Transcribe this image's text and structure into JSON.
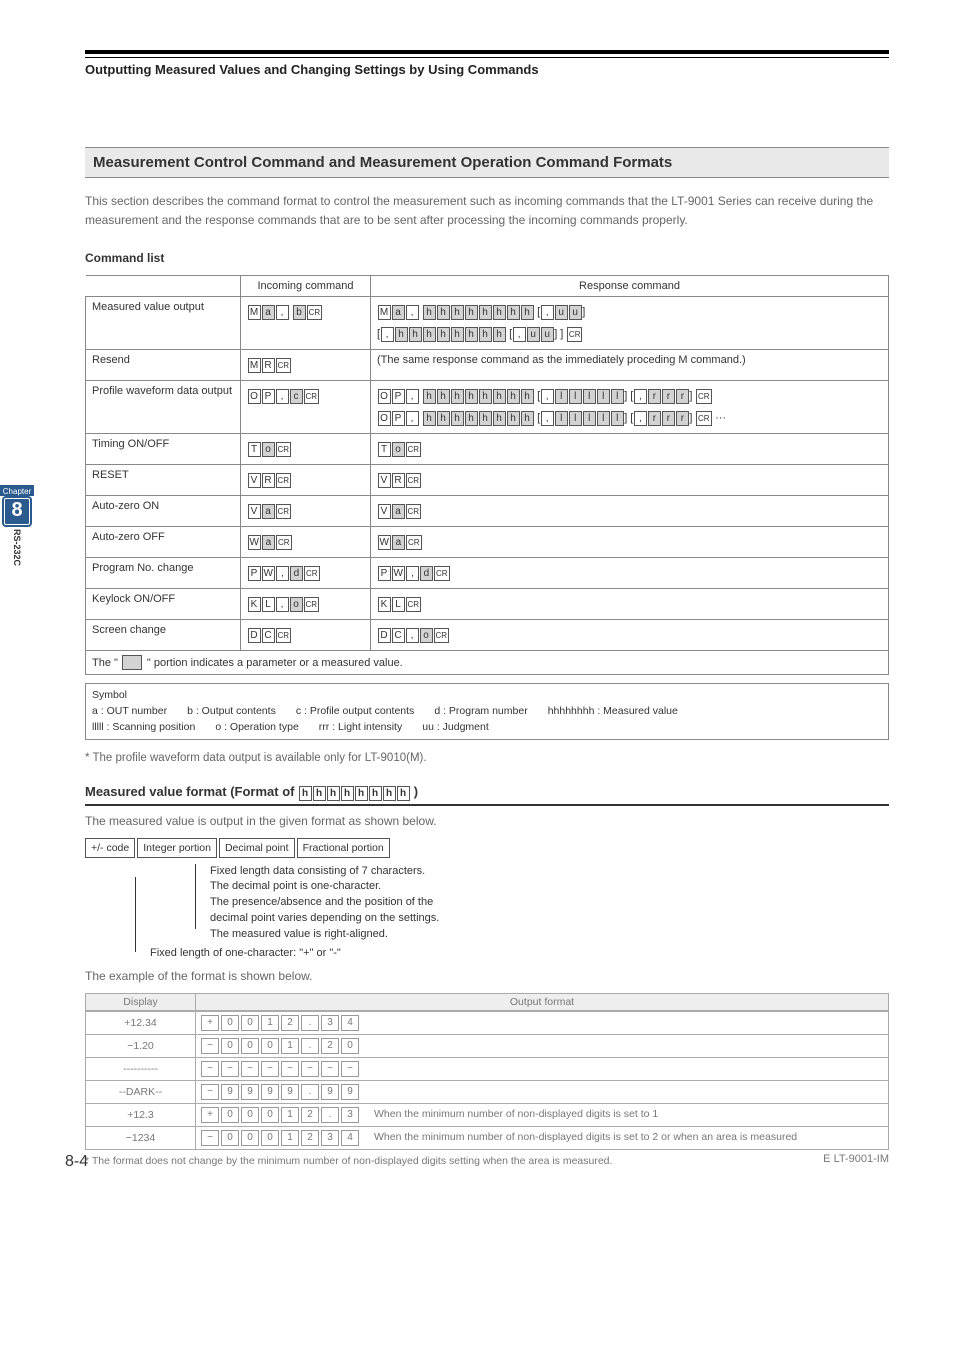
{
  "page": {
    "header_title": "Outputting Measured Values and Changing Settings by Using Commands",
    "section_title": "Measurement Control Command and Measurement Operation Command Formats",
    "intro": "This section describes the command format to control the measurement such as incoming commands that the LT-9001 Series can receive during the measurement and the response commands that are to be sent after processing the incoming commands properly.",
    "command_list_label": "Command list"
  },
  "sidebar": {
    "chapter_label": "Chapter",
    "chapter_num": "8",
    "rs_label": "RS-232C"
  },
  "cmd_table": {
    "headers": {
      "incoming": "Incoming command",
      "response": "Response command"
    },
    "rows": [
      {
        "name": "Measured value output"
      },
      {
        "name": "Resend",
        "response_text": "(The same response command as the immediately proceding M command.)"
      },
      {
        "name": "Profile waveform data output"
      },
      {
        "name": "Timing ON/OFF"
      },
      {
        "name": "RESET"
      },
      {
        "name": "Auto-zero ON"
      },
      {
        "name": "Auto-zero OFF"
      },
      {
        "name": "Program No. change"
      },
      {
        "name": "Keylock ON/OFF"
      },
      {
        "name": "Screen change"
      }
    ],
    "note_prefix": "The \"",
    "note_suffix": "\" portion indicates a parameter or a measured value."
  },
  "symbols": {
    "title": "Symbol",
    "items": {
      "a": "a : OUT number",
      "b": "b : Output contents",
      "c": "c : Profile output contents",
      "d": "d : Program number",
      "h": "hhhhhhhh : Measured value",
      "l": "lllll : Scanning position",
      "o": "o : Operation type",
      "r": "rrr : Light intensity",
      "u": "uu : Judgment"
    }
  },
  "profile_note": "* The profile waveform data output is available only for LT-9010(M).",
  "measured_format": {
    "title_prefix": "Measured value format (Format of ",
    "title_suffix": ")",
    "boxes": [
      "h",
      "h",
      "h",
      "h",
      "h",
      "h",
      "h",
      "h"
    ],
    "description": "The measured value is output in the given format as shown below.",
    "parts": [
      "+/- code",
      "Integer portion",
      "Decimal point",
      "Fractional portion"
    ],
    "desc_lines": [
      "Fixed length data consisting of 7 characters.",
      "The decimal point is one-character.",
      "The presence/absence and the position of the",
      "decimal point varies depending on the settings.",
      "The measured value is right-aligned."
    ],
    "desc2": "Fixed length of one-character: \"+\" or \"-\""
  },
  "examples": {
    "intro": "The example of the format is shown below.",
    "headers": {
      "display": "Display",
      "output": "Output format"
    },
    "rows": [
      {
        "display": "+12.34",
        "chars": [
          "+",
          "0",
          "0",
          "1",
          "2",
          ".",
          "3",
          "4"
        ],
        "note": ""
      },
      {
        "display": "−1.20",
        "chars": [
          "−",
          "0",
          "0",
          "0",
          "1",
          ".",
          "2",
          "0"
        ],
        "note": ""
      },
      {
        "display": "----------",
        "chars": [
          "−",
          "−",
          "−",
          "−",
          "−",
          "−",
          "−",
          "−"
        ],
        "note": ""
      },
      {
        "display": "--DARK--",
        "chars": [
          "−",
          "9",
          "9",
          "9",
          "9",
          ".",
          "9",
          "9"
        ],
        "note": ""
      },
      {
        "display": "+12.3",
        "chars": [
          "+",
          "0",
          "0",
          "0",
          "1",
          "2",
          ".",
          "3"
        ],
        "note": "When the minimum number of non-displayed digits is set to 1"
      },
      {
        "display": "−1234",
        "chars": [
          "−",
          "0",
          "0",
          "0",
          "1",
          "2",
          "3",
          "4"
        ],
        "note": "When the minimum number of non-displayed digits is set to 2 or when an area is measured"
      }
    ],
    "post_note": "* The format does not change by the minimum number of non-displayed digits setting when the area is measured."
  },
  "footer": {
    "page_num": "8-4",
    "doc_id": "E LT-9001-IM"
  }
}
